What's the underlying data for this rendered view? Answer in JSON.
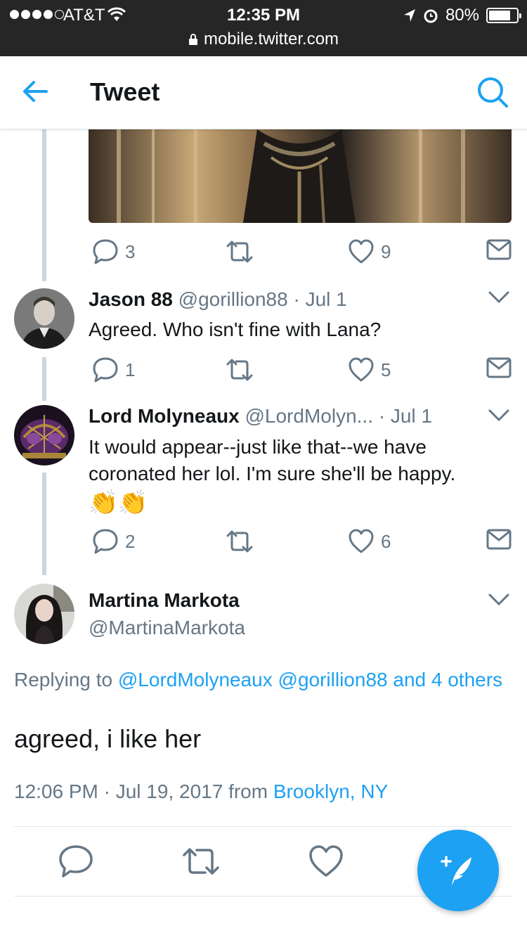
{
  "status_bar": {
    "carrier": "AT&T",
    "time": "12:35 PM",
    "battery": "80%",
    "battery_level": 0.8,
    "url": "mobile.twitter.com"
  },
  "header": {
    "title": "Tweet"
  },
  "previous_tweet": {
    "reply_count": "3",
    "like_count": "9"
  },
  "replies": [
    {
      "name": "Jason 88",
      "handle_date": "@gorillion88 · Jul 1",
      "text": "Agreed. Who isn't fine with Lana?",
      "reply_count": "1",
      "like_count": "5"
    },
    {
      "name": "Lord Molyneaux",
      "handle_date": "@LordMolyn...  · Jul 1",
      "text_line1": "It would appear--just like that--we have",
      "text_line2": "coronated her lol.  I'm sure she'll be happy.",
      "emoji": "👏👏",
      "reply_count": "2",
      "like_count": "6"
    }
  ],
  "main_tweet": {
    "name": "Martina Markota",
    "handle": "@MartinaMarkota",
    "replying_prefix": "Replying to ",
    "replying_links": "@LordMolyneaux @gorillion88 and 4 others",
    "text": "agreed, i like her",
    "timestamp": "12:06 PM · Jul 19, 2017 from ",
    "location": "Brooklyn, NY"
  },
  "colors": {
    "accent": "#1da1f2",
    "muted": "#657786",
    "thread": "#ccd6dd",
    "status_bar": "#262626"
  },
  "icons": [
    "signal-icon",
    "wifi-icon",
    "location-arrow-icon",
    "alarm-icon",
    "battery-icon",
    "lock-icon",
    "back-arrow-icon",
    "search-icon",
    "reply-icon",
    "retweet-icon",
    "like-icon",
    "direct-message-icon",
    "chevron-down-icon",
    "compose-tweet-icon"
  ]
}
